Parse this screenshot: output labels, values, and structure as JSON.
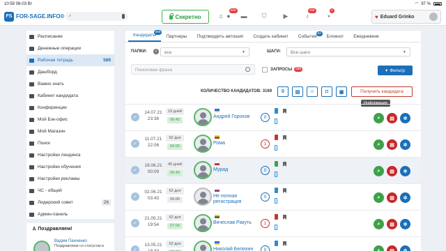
{
  "status_bar": {
    "time": "10:59",
    "date": "08-03 Вт",
    "battery": "97 %"
  },
  "header": {
    "logo_text": "FOR-SAGE.INFO®",
    "logo_mark": "FS",
    "search_placeholder": "",
    "secret_label": "Секретно",
    "badges": {
      "people": "605",
      "notifications": "269",
      "messages": "3"
    },
    "user_name": "Eduard Grinko"
  },
  "sidebar": {
    "items": [
      {
        "label": "Расписание",
        "count": ""
      },
      {
        "label": "Денежные операции",
        "count": ""
      },
      {
        "label": "Рабочая тетрадь",
        "count": "589"
      },
      {
        "label": "Дашборд",
        "count": ""
      },
      {
        "label": "Важно знать",
        "count": ""
      },
      {
        "label": "Кабинет кандидата",
        "count": ""
      },
      {
        "label": "Конференции",
        "count": ""
      },
      {
        "label": "Мой Бэк-офис",
        "count": ""
      },
      {
        "label": "Мой Магазин",
        "count": ""
      },
      {
        "label": "Поиск",
        "count": ""
      },
      {
        "label": "Настройки лендинга",
        "count": ""
      },
      {
        "label": "Настройки обучения",
        "count": ""
      },
      {
        "label": "Настройки рекламы",
        "count": ""
      },
      {
        "label": "ЧС - общий",
        "count": ""
      },
      {
        "label": "Лидерский совет",
        "count": "26"
      },
      {
        "label": "Админ-панель",
        "count": ""
      }
    ]
  },
  "congrats": {
    "title": "Поздравляем!",
    "name": "Вадим Панченко",
    "text": "Поздравляем со статусом в"
  },
  "tabs": [
    {
      "label": "Кандидаты",
      "badge": "589"
    },
    {
      "label": "Партнеры",
      "badge": ""
    },
    {
      "label": "Подтвердить автошип",
      "badge": ""
    },
    {
      "label": "Создать кабинет",
      "badge": ""
    },
    {
      "label": "События",
      "badge": "54"
    },
    {
      "label": "Блокнот",
      "badge": ""
    },
    {
      "label": "Ежедневник",
      "badge": ""
    }
  ],
  "filters": {
    "folders_label": "ПАПКИ:",
    "folders_value": "все",
    "steps_label": "ШАГИ:",
    "steps_value": "Все шаги",
    "phrase_placeholder": "Поисковая фраза",
    "requests_label": "ЗАПРОСЫ",
    "requests_count": "589",
    "filter_button": "Фильтр"
  },
  "counts": {
    "label": "КОЛИЧЕСТВО КАНДИДАТОВ: 3169",
    "zero_value": "0",
    "get_button": "Получить кандидата",
    "tooltip": "Информация"
  },
  "candidates": [
    {
      "date": "14.07.21",
      "time": "23:38",
      "days": "19 дней",
      "slot": "06:45",
      "name": "Андрей Горохов",
      "flag": "ua",
      "count": "0",
      "red": false,
      "hl": false,
      "ava": "green",
      "slotgrey": false
    },
    {
      "date": "11.07.21",
      "time": "22:06",
      "days": "62 дня",
      "slot": "06:00",
      "name": "Рома",
      "flag": "lt",
      "count": "1",
      "red": true,
      "hl": false,
      "ava": "green",
      "slotgrey": false
    },
    {
      "date": "19.06.21",
      "time": "00:09",
      "days": "45 дней",
      "slot": "06:45",
      "name": "Мурад",
      "flag": "ru",
      "count": "0",
      "red": false,
      "hl": true,
      "ava": "green",
      "slotgrey": false
    },
    {
      "date": "02.06.21",
      "time": "03:43",
      "days": "62 дня",
      "slot": "00:00",
      "name": "Не полная регистрация",
      "flag": "ru",
      "count": "0",
      "red": false,
      "hl": false,
      "ava": "grey",
      "slotgrey": true
    },
    {
      "date": "21.05.21",
      "time": "19:54",
      "days": "62 дня",
      "slot": "07:00",
      "name": "Вячеслав Ракуть",
      "flag": "lt",
      "count": "1",
      "red": true,
      "hl": false,
      "ava": "green",
      "slotgrey": false
    },
    {
      "date": "13.05.21",
      "time": "18:33",
      "days": "62 дня",
      "slot": "07:15",
      "name": "Николай Белихин",
      "flag": "ua",
      "count": "0",
      "red": false,
      "hl": false,
      "ava": "green",
      "slotgrey": false
    }
  ]
}
